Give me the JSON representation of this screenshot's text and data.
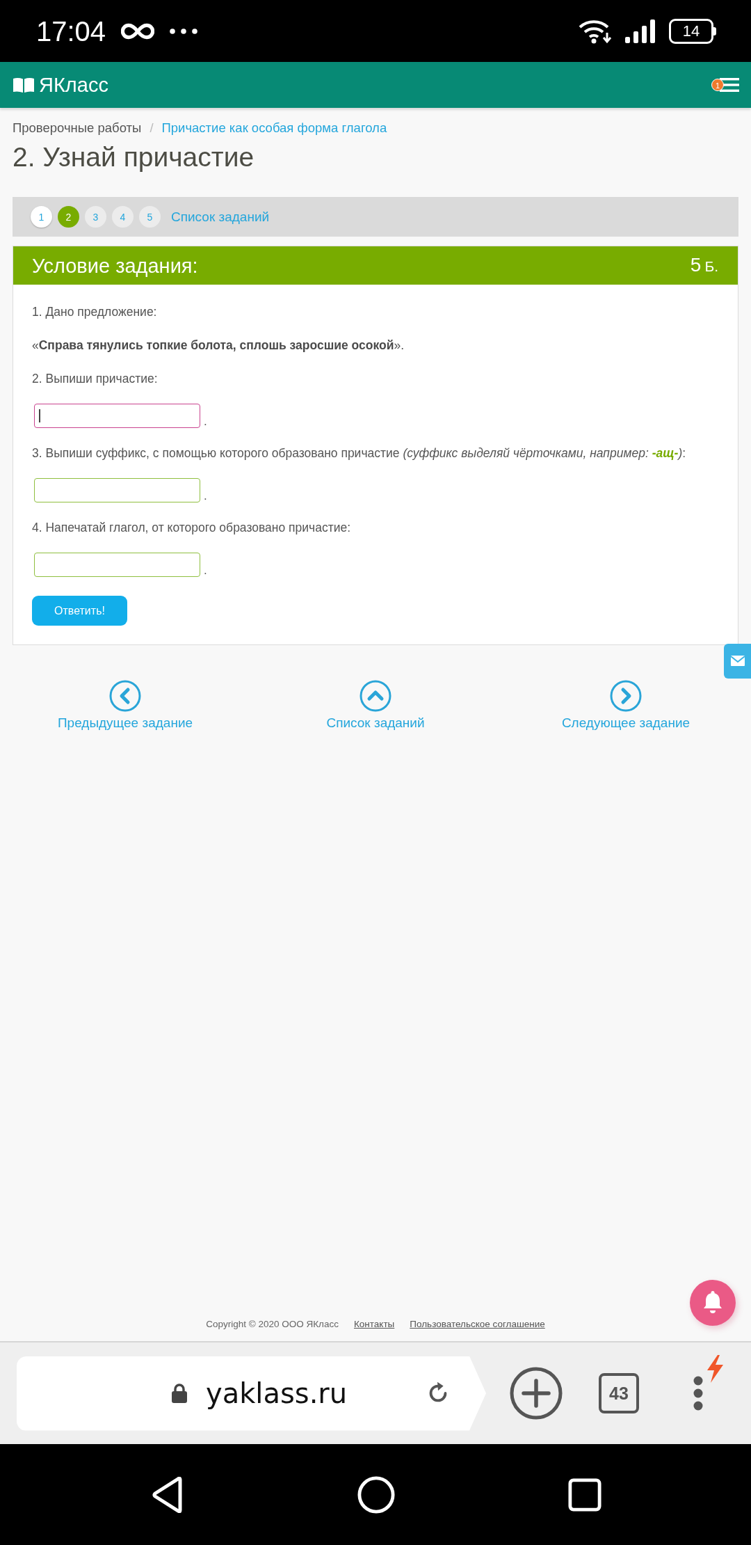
{
  "status_bar": {
    "time": "17:04",
    "battery": "14"
  },
  "header": {
    "logo": "ЯКласс",
    "badge": "1"
  },
  "breadcrumb": {
    "items": [
      {
        "label": "Проверочные работы",
        "kind": "plain"
      },
      {
        "label": "Причастие как особая форма глагола",
        "kind": "link"
      }
    ],
    "separator": "/"
  },
  "title": "2. Узнай причастие",
  "task_nav": {
    "tasks": [
      {
        "label": "1",
        "selected": false,
        "visited": true
      },
      {
        "label": "2",
        "selected": true,
        "visited": false
      },
      {
        "label": "3",
        "selected": false,
        "visited": false
      },
      {
        "label": "4",
        "selected": false,
        "visited": false
      },
      {
        "label": "5",
        "selected": false,
        "visited": false
      }
    ],
    "list_link": "Список заданий"
  },
  "task": {
    "heading": "Условие задания:",
    "points": "5",
    "points_unit": "Б.",
    "items": [
      {
        "kind": "text",
        "text": "1. Дано предложение:"
      },
      {
        "kind": "text",
        "text": "«**Справа тянулись топкие болота, сплошь заросшие осокой**»."
      },
      {
        "kind": "text",
        "text": "2. Выпиши причастие:"
      },
      {
        "kind": "field",
        "focused": true,
        "suffix": "."
      },
      {
        "kind": "text",
        "parts": [
          {
            "kind": "plain",
            "text": "3. Выпиши суффикс, с помощью которого образовано причастие "
          },
          {
            "kind": "italic",
            "text": "(суффикс выделяй чёрточками, например: "
          },
          {
            "kind": "accent",
            "text": "-ащ-"
          },
          {
            "kind": "italic",
            "text": ")"
          },
          {
            "kind": "plain",
            "text": ":"
          }
        ]
      },
      {
        "kind": "field",
        "focused": false,
        "suffix": "."
      },
      {
        "kind": "text",
        "text": "4. Напечатай глагол, от которого образовано причастие:"
      },
      {
        "kind": "field",
        "focused": false,
        "suffix": "."
      },
      {
        "kind": "button",
        "label": "Ответить!"
      }
    ]
  },
  "bottom_nav": [
    {
      "kind": "prev",
      "label": "Предыдущее задание"
    },
    {
      "kind": "list",
      "label": "Список заданий"
    },
    {
      "kind": "next",
      "label": "Следующее задание"
    }
  ],
  "footer": {
    "copyright": "Copyright © 2020 ООО ЯКласс",
    "links": [
      "Контакты",
      "Пользовательское соглашение"
    ]
  },
  "browser": {
    "url": "yaklass.ru",
    "tab_count": "43"
  }
}
